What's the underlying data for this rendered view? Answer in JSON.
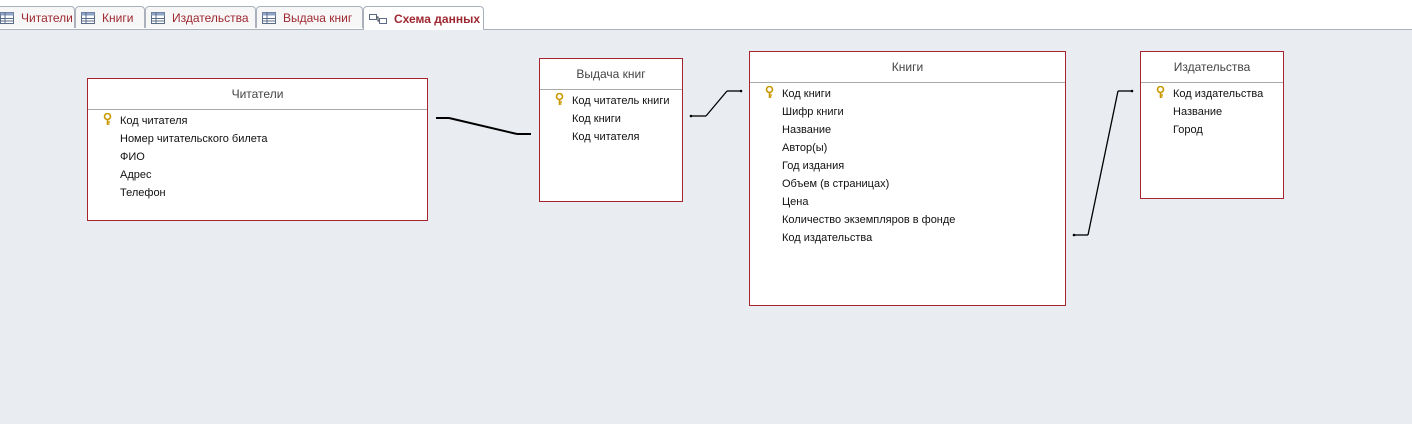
{
  "tabs": [
    {
      "label": "Читатели",
      "icon": "table-icon"
    },
    {
      "label": "Книги",
      "icon": "table-icon"
    },
    {
      "label": "Издательства",
      "icon": "table-icon"
    },
    {
      "label": "Выдача книг",
      "icon": "table-icon"
    },
    {
      "label": "Схема данных",
      "icon": "relationships-icon",
      "active": true
    }
  ],
  "tables": {
    "readers": {
      "title": "Читатели",
      "fields": [
        "Код читателя",
        "Номер читательского билета",
        "ФИО",
        "Адрес",
        "Телефон"
      ],
      "key_field": "Код читателя"
    },
    "issues": {
      "title": "Выдача книг",
      "fields": [
        "Код читатель книги",
        "Код книги",
        "Код читателя"
      ],
      "key_field": "Код читатель книги"
    },
    "books": {
      "title": "Книги",
      "fields": [
        "Код книги",
        "Шифр книги",
        "Название",
        "Автор(ы)",
        "Год издания",
        "Объем (в страницах)",
        "Цена",
        "Количество экземпляров в фонде",
        "Код издательства"
      ],
      "key_field": "Код книги"
    },
    "publishers": {
      "title": "Издательства",
      "fields": [
        "Код издательства",
        "Название",
        "Город"
      ],
      "key_field": "Код издательства"
    }
  },
  "colors": {
    "accent": "#a4262c",
    "canvas": "#e9ecf1",
    "key": "#d9a400"
  }
}
